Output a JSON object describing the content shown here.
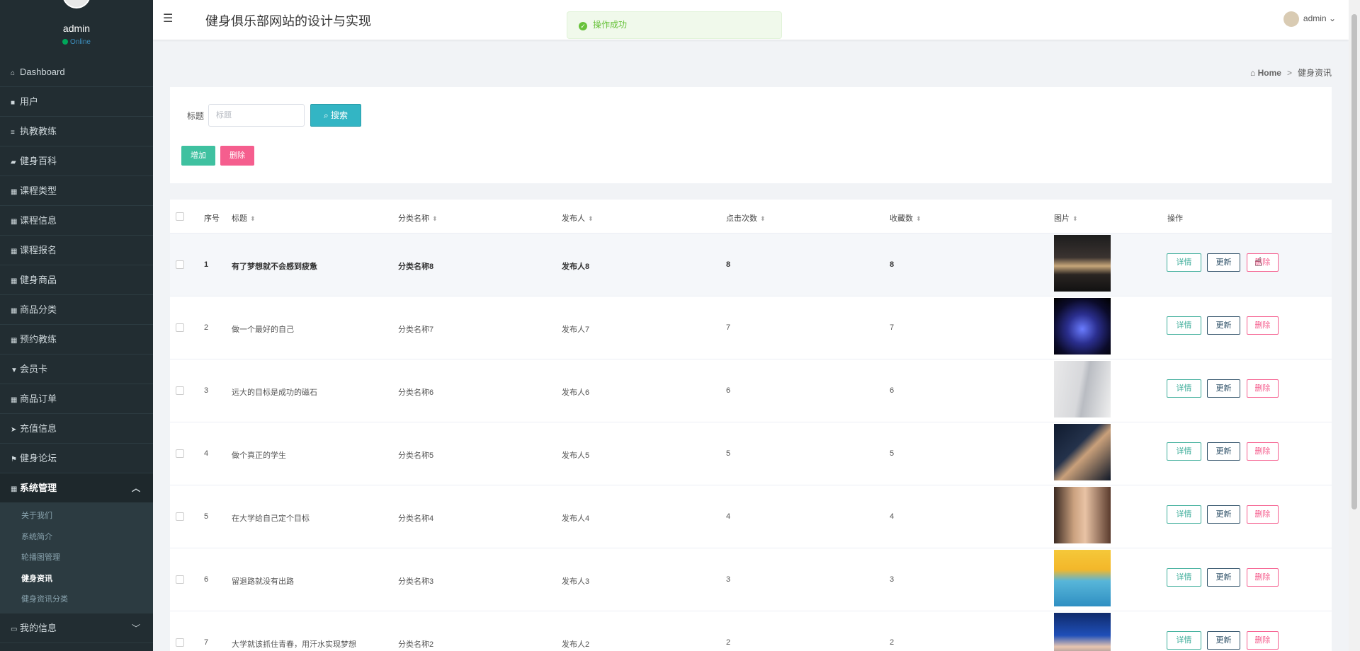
{
  "app": {
    "title": "健身俱乐部网站的设计与实现"
  },
  "sidebar": {
    "user_name": "admin",
    "status": "Online",
    "items": [
      {
        "label": "Dashboard",
        "icon": "home-icon"
      },
      {
        "label": "用户",
        "icon": "user-icon"
      },
      {
        "label": "执教教练",
        "icon": "list-icon"
      },
      {
        "label": "健身百科",
        "icon": "book-icon"
      },
      {
        "label": "课程类型",
        "icon": "grid-icon"
      },
      {
        "label": "课程信息",
        "icon": "grid-icon"
      },
      {
        "label": "课程报名",
        "icon": "grid-icon"
      },
      {
        "label": "健身商品",
        "icon": "grid-icon"
      },
      {
        "label": "商品分类",
        "icon": "grid-icon"
      },
      {
        "label": "预约教练",
        "icon": "grid-icon"
      },
      {
        "label": "会员卡",
        "icon": "trophy-icon"
      },
      {
        "label": "商品订单",
        "icon": "grid-icon"
      },
      {
        "label": "充值信息",
        "icon": "send-icon"
      },
      {
        "label": "健身论坛",
        "icon": "flag-icon"
      },
      {
        "label": "系统管理",
        "icon": "grid-icon"
      }
    ],
    "submenu": [
      "关于我们",
      "系统简介",
      "轮播图管理",
      "健身资讯",
      "健身资讯分类"
    ],
    "last_item": {
      "label": "我的信息",
      "icon": "card-icon"
    }
  },
  "header": {
    "user_label": "admin"
  },
  "toast": {
    "message": "操作成功"
  },
  "breadcrumb": {
    "home": "Home",
    "current": "健身资讯"
  },
  "search": {
    "label": "标题",
    "placeholder": "标题",
    "button": "搜索"
  },
  "actions": {
    "add": "增加",
    "delete": "删除"
  },
  "table": {
    "columns": [
      "序号",
      "标题",
      "分类名称",
      "发布人",
      "点击次数",
      "收藏数",
      "图片",
      "操作"
    ],
    "row_actions": {
      "detail": "详情",
      "update": "更新",
      "delete": "删除"
    },
    "rows": [
      {
        "no": "1",
        "title": "有了梦想就不会感到疲惫",
        "category": "分类名称8",
        "publisher": "发布人8",
        "clicks": "8",
        "favorites": "8"
      },
      {
        "no": "2",
        "title": "做一个最好的自己",
        "category": "分类名称7",
        "publisher": "发布人7",
        "clicks": "7",
        "favorites": "7"
      },
      {
        "no": "3",
        "title": "远大的目标是成功的磁石",
        "category": "分类名称6",
        "publisher": "发布人6",
        "clicks": "6",
        "favorites": "6"
      },
      {
        "no": "4",
        "title": "做个真正的学生",
        "category": "分类名称5",
        "publisher": "发布人5",
        "clicks": "5",
        "favorites": "5"
      },
      {
        "no": "5",
        "title": "在大学给自己定个目标",
        "category": "分类名称4",
        "publisher": "发布人4",
        "clicks": "4",
        "favorites": "4"
      },
      {
        "no": "6",
        "title": "留退路就没有出路",
        "category": "分类名称3",
        "publisher": "发布人3",
        "clicks": "3",
        "favorites": "3"
      },
      {
        "no": "7",
        "title": "大学就该抓住青春，用汗水实现梦想",
        "category": "分类名称2",
        "publisher": "发布人2",
        "clicks": "2",
        "favorites": "2"
      }
    ]
  }
}
